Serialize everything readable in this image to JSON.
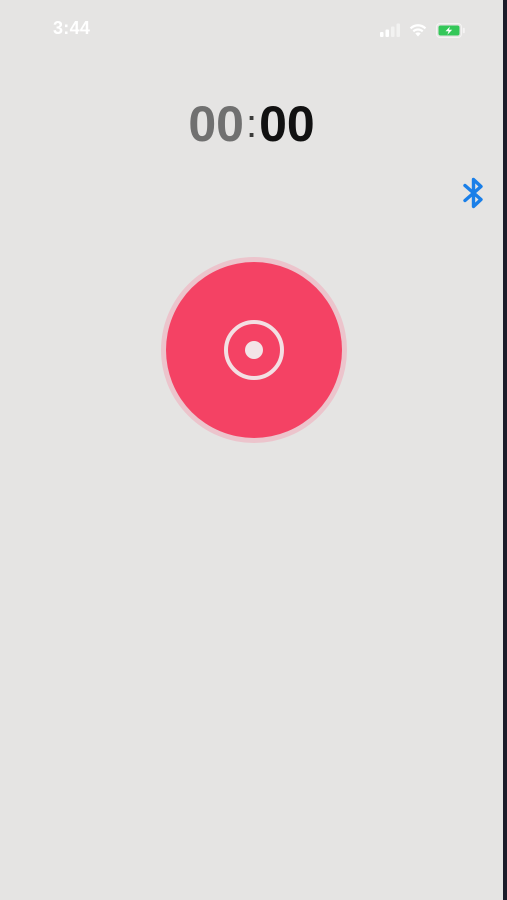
{
  "status_bar": {
    "time": "3:44",
    "icons": [
      "signal-icon",
      "wifi-icon",
      "battery-charging-icon"
    ],
    "battery_color": "#34c759"
  },
  "timer": {
    "minutes": "00",
    "separator": ":",
    "seconds": "00"
  },
  "bluetooth": {
    "icon": "bluetooth-icon",
    "color": "#1a7fe8"
  },
  "record_button": {
    "icon": "record-icon",
    "color": "#f44264"
  },
  "colors": {
    "background": "#e5e4e3"
  }
}
